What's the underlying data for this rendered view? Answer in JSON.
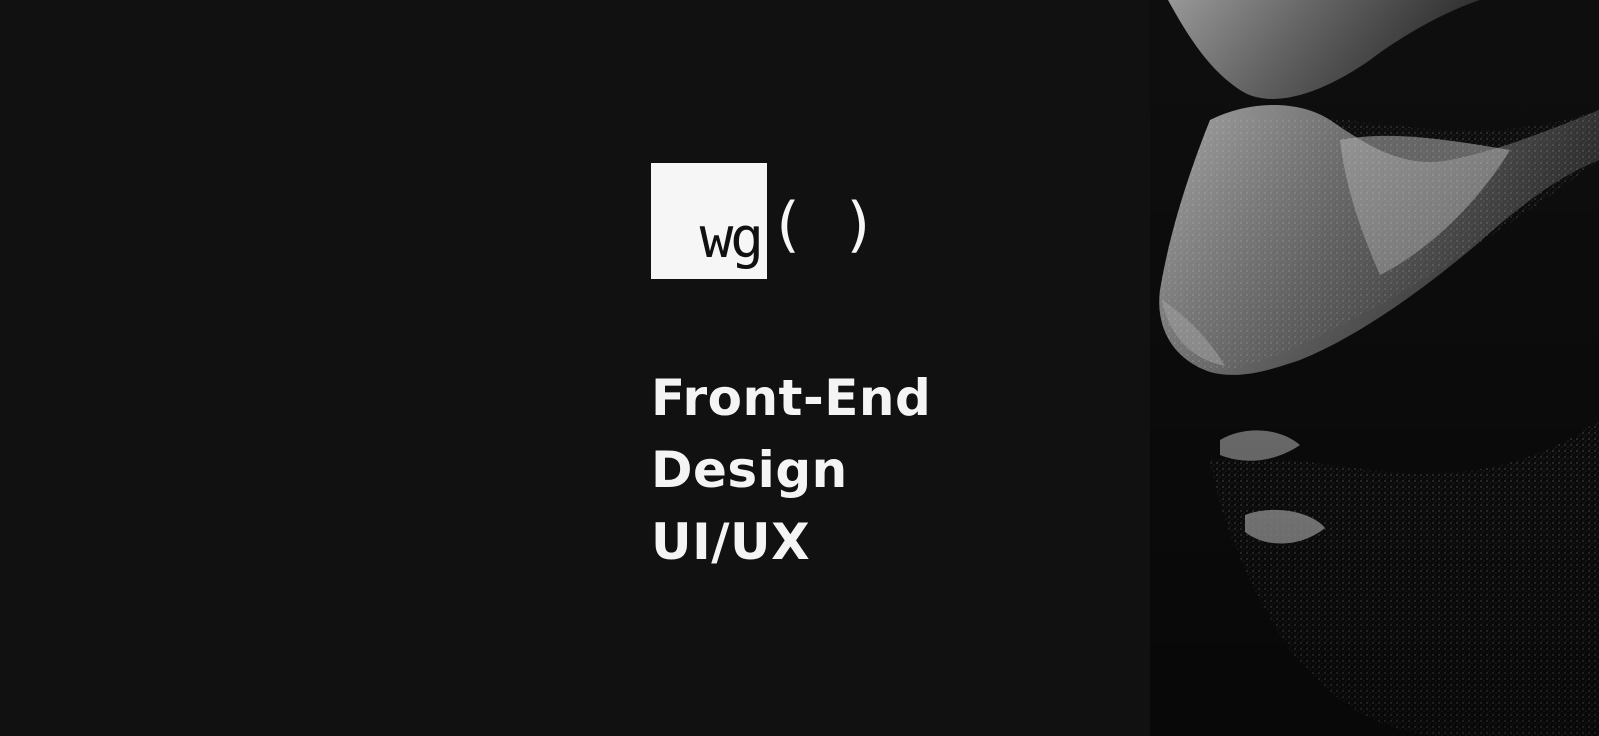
{
  "logo": {
    "mark": "wg",
    "parens": "( )"
  },
  "headline": {
    "lines": [
      "Front-End",
      "Design",
      "UI/UX"
    ]
  },
  "colors": {
    "background": "#111112",
    "text": "#f4f4f4",
    "logo_box": "#f6f6f6"
  },
  "hero_image": {
    "icon": "face-profile-photo"
  }
}
